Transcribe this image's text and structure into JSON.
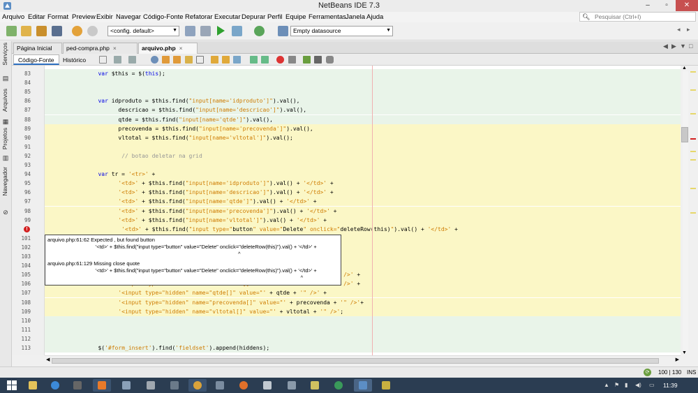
{
  "window": {
    "title": "NetBeans IDE 7.3",
    "min": "–",
    "max": "▫",
    "close": "✕"
  },
  "menu": [
    "Arquivo",
    "Editar",
    "Format",
    "Preview",
    "Exibir",
    "Navegar",
    "Código-Fonte",
    "Refatorar",
    "Executar",
    "Depurar",
    "Perfil",
    "Equipe",
    "Ferramentas",
    "Janela",
    "Ajuda"
  ],
  "search": {
    "placeholder": "Pesquisar (Ctrl+I)",
    "icon": "search-icon"
  },
  "toolbar": {
    "config": "<config. default>",
    "datasource": "Empty datasource"
  },
  "side_tabs": [
    "Serviços",
    "Arquivos",
    "Projetos",
    "Navegador"
  ],
  "tabs": [
    {
      "label": "Página Inicial",
      "active": false
    },
    {
      "label": "ped-compra.php",
      "active": false
    },
    {
      "label": "arquivo.php",
      "active": true
    }
  ],
  "views": {
    "source": "Código-Fonte",
    "history": "Histórico"
  },
  "code": [
    {
      "n": "83",
      "bg": "g",
      "indent": 14,
      "seg": [
        [
          "kw",
          "var "
        ],
        [
          "",
          "$this = $("
        ],
        [
          "kw",
          "this"
        ],
        [
          "",
          ");"
        ]
      ]
    },
    {
      "n": "84",
      "bg": "g",
      "indent": 0,
      "seg": []
    },
    {
      "n": "85",
      "bg": "g",
      "indent": 0,
      "seg": []
    },
    {
      "n": "86",
      "bg": "g",
      "indent": 14,
      "seg": [
        [
          "kw",
          "var "
        ],
        [
          "",
          "idproduto = $this.find("
        ],
        [
          "str",
          "\"input[name='idproduto']\""
        ],
        [
          "",
          ").val(),"
        ]
      ]
    },
    {
      "n": "87",
      "bg": "g",
      "indent": 20,
      "seg": [
        [
          "",
          "descricao = $this.find("
        ],
        [
          "str",
          "\"input[name='descricao']\""
        ],
        [
          "",
          ").val(),"
        ]
      ]
    },
    {
      "n": "88",
      "bg": "g",
      "indent": 20,
      "seg": [
        [
          "",
          "qtde = $this.find("
        ],
        [
          "str",
          "\"input[name='qtde']\""
        ],
        [
          "",
          ").val(),"
        ]
      ]
    },
    {
      "n": "89",
      "bg": "y",
      "indent": 20,
      "seg": [
        [
          "",
          "precovenda = $this.find("
        ],
        [
          "str",
          "\"input[name='precovenda']\""
        ],
        [
          "",
          ").val(),"
        ]
      ]
    },
    {
      "n": "90",
      "bg": "y",
      "indent": 20,
      "seg": [
        [
          "",
          "vltotal = $this.find("
        ],
        [
          "str",
          "\"input[name='vltotal']\""
        ],
        [
          "",
          ").val();"
        ]
      ]
    },
    {
      "n": "91",
      "bg": "y",
      "indent": 0,
      "seg": []
    },
    {
      "n": "92",
      "bg": "y",
      "indent": 21,
      "seg": [
        [
          "cm",
          "// botao deletar na grid"
        ]
      ]
    },
    {
      "n": "93",
      "bg": "y",
      "indent": 0,
      "seg": []
    },
    {
      "n": "94",
      "bg": "y",
      "indent": 14,
      "seg": [
        [
          "kw",
          "var "
        ],
        [
          "",
          "tr = "
        ],
        [
          "str",
          "'<tr>'"
        ],
        [
          "",
          " +"
        ]
      ]
    },
    {
      "n": "95",
      "bg": "y",
      "indent": 20,
      "seg": [
        [
          "str",
          "'<td>'"
        ],
        [
          "",
          " + $this.find("
        ],
        [
          "str",
          "\"input[name='idproduto']\""
        ],
        [
          "",
          ").val() + "
        ],
        [
          "str",
          "'</td>'"
        ],
        [
          "",
          " +"
        ]
      ]
    },
    {
      "n": "96",
      "bg": "y",
      "indent": 20,
      "seg": [
        [
          "str",
          "'<td>'"
        ],
        [
          "",
          " + $this.find("
        ],
        [
          "str",
          "\"input[name='descricao']\""
        ],
        [
          "",
          ").val() + "
        ],
        [
          "str",
          "'</td>'"
        ],
        [
          "",
          " +"
        ]
      ]
    },
    {
      "n": "97",
      "bg": "y",
      "indent": 20,
      "seg": [
        [
          "str",
          "'<td>'"
        ],
        [
          "",
          " + $this.find("
        ],
        [
          "str",
          "\"input[name='qtde']\""
        ],
        [
          "",
          ").val() + "
        ],
        [
          "str",
          "'</td>'"
        ],
        [
          "",
          " +"
        ]
      ]
    },
    {
      "n": "98",
      "bg": "y",
      "indent": 20,
      "seg": [
        [
          "str",
          "'<td>'"
        ],
        [
          "",
          " + $this.find("
        ],
        [
          "str",
          "\"input[name='precovenda']\""
        ],
        [
          "",
          ").val() + "
        ],
        [
          "str",
          "'</td>'"
        ],
        [
          "",
          " +"
        ]
      ]
    },
    {
      "n": "99",
      "bg": "y",
      "indent": 20,
      "seg": [
        [
          "str",
          "'<td>'"
        ],
        [
          "",
          " + $this.find("
        ],
        [
          "str",
          "\"input[name='vltotal']\""
        ],
        [
          "",
          ").val() + "
        ],
        [
          "str",
          "'</td>'"
        ],
        [
          "",
          " +"
        ]
      ]
    },
    {
      "n": "",
      "bg": "y",
      "indent": 21,
      "err": true,
      "seg": [
        [
          "str",
          "'<td>'"
        ],
        [
          "",
          " + $this.find("
        ],
        [
          "str",
          "\"input type=\""
        ],
        [
          "",
          "button"
        ],
        [
          "str",
          "\" value=\""
        ],
        [
          "",
          "Delete"
        ],
        [
          "str",
          "\" onclick=\""
        ],
        [
          "",
          "deleteRow(this)"
        ],
        [
          "str",
          "\""
        ],
        [
          "",
          ").val() + "
        ],
        [
          "str",
          "'</td>'"
        ],
        [
          "",
          " +"
        ]
      ]
    },
    {
      "n": "101",
      "bg": "y",
      "indent": 0,
      "seg": []
    },
    {
      "n": "102",
      "bg": "y",
      "indent": 0,
      "seg": []
    },
    {
      "n": "103",
      "bg": "y",
      "indent": 0,
      "seg": []
    },
    {
      "n": "104",
      "bg": "y",
      "indent": 0,
      "seg": []
    },
    {
      "n": "105",
      "bg": "y",
      "indent": 20,
      "seg": [
        [
          "str",
          "'<input type=\"hidden\" name=\"idproduto[]\" value=\"'"
        ],
        [
          "",
          " + idproduto + "
        ],
        [
          "str",
          "'\" />'"
        ],
        [
          "",
          " +"
        ]
      ]
    },
    {
      "n": "106",
      "bg": "y",
      "indent": 20,
      "seg": [
        [
          "str",
          "'<input type=\"hidden\" name=\"descricao[]\" value=\"'"
        ],
        [
          "",
          " + descricao + "
        ],
        [
          "str",
          "'\" />'"
        ],
        [
          "",
          " +"
        ]
      ]
    },
    {
      "n": "107",
      "bg": "y",
      "indent": 20,
      "seg": [
        [
          "str",
          "'<input type=\"hidden\" name=\"qtde[]\" value=\"'"
        ],
        [
          "",
          " + qtde + "
        ],
        [
          "str",
          "'\" />'"
        ],
        [
          "",
          " +"
        ]
      ]
    },
    {
      "n": "108",
      "bg": "y",
      "indent": 20,
      "seg": [
        [
          "str",
          "'<input type=\"hidden\" name=\"precovenda[]\" value=\"'"
        ],
        [
          "",
          " + precovenda + "
        ],
        [
          "str",
          "'\" />'"
        ],
        [
          "",
          "+"
        ]
      ]
    },
    {
      "n": "109",
      "bg": "y",
      "indent": 20,
      "seg": [
        [
          "str",
          "'<input type=\"hidden\" name=\"vltotal[]\" value=\"'"
        ],
        [
          "",
          " + vltotal + "
        ],
        [
          "str",
          "'\" />'"
        ],
        [
          "",
          ";"
        ]
      ]
    },
    {
      "n": "110",
      "bg": "g",
      "indent": 0,
      "seg": []
    },
    {
      "n": "111",
      "bg": "g",
      "indent": 0,
      "seg": []
    },
    {
      "n": "112",
      "bg": "g",
      "indent": 0,
      "seg": []
    },
    {
      "n": "113",
      "bg": "g",
      "indent": 14,
      "seg": [
        [
          "",
          "$("
        ],
        [
          "str",
          "'#form_insert'"
        ],
        [
          "",
          ").find("
        ],
        [
          "str",
          "'fieldset'"
        ],
        [
          "",
          ").append(hiddens);"
        ]
      ]
    }
  ],
  "tooltip": {
    "err1": "arquivo.php:61:62 Expected , but found button",
    "ctx1": "                                 '<td>' + $this.find(\"input type=\"button\" value=\"Delete\" onclick=\"deleteRow(this)\").val() + '</td>' +",
    "caret1": "                                                                                                                                   ^",
    "err2": "arquivo.php:61:129 Missing close quote",
    "ctx2": "                                 '<td>' + $this.find(\"input type=\"button\" value=\"Delete\" onclick=\"deleteRow(this)\").val() + '</td>' +",
    "caret2": "                                                                                                                                                                              ^"
  },
  "status": {
    "position": "100 | 130",
    "mode": "INS"
  },
  "taskbar": {
    "time": "11:39"
  }
}
